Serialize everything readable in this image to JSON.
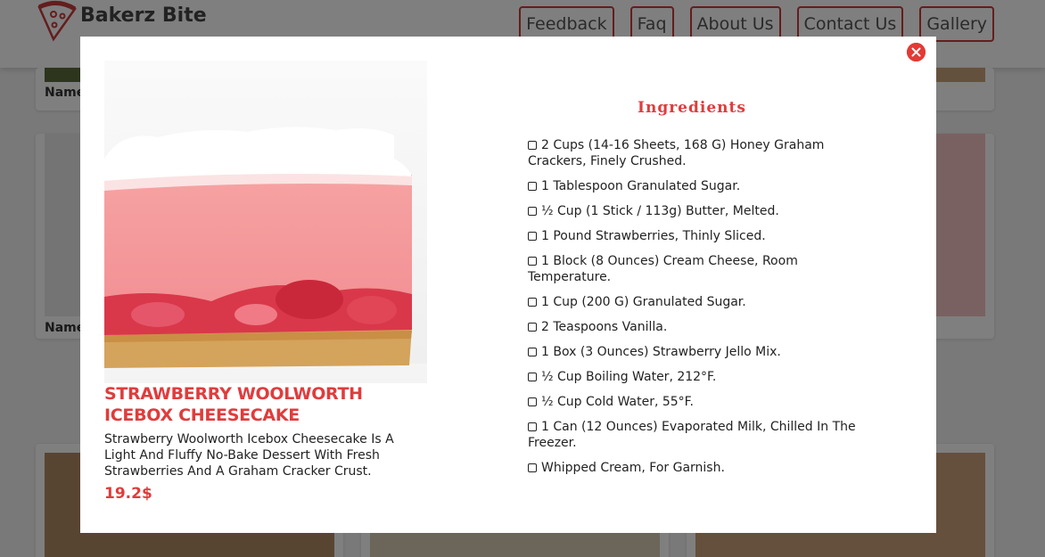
{
  "navbar": {
    "brand": "Bakerz Bite",
    "links": [
      "Feedback",
      "Faq",
      "About Us",
      "Contact Us",
      "Gallery"
    ]
  },
  "background_cards": {
    "name_label_1": "Name",
    "name_label_2": "Name"
  },
  "modal": {
    "product": {
      "title": "Strawberry Woolworth Icebox Cheesecake",
      "description": "Strawberry Woolworth Icebox Cheesecake Is A Light And Fluffy No-Bake Dessert With Fresh Strawberries And A Graham Cracker Crust.",
      "price": "19.2$"
    },
    "ingredients_title": "Ingredients",
    "ingredients": [
      "2 Cups (14-16 Sheets, 168 G) Honey Graham Crackers, Finely Crushed.",
      "1 Tablespoon Granulated Sugar.",
      "½ Cup (1 Stick / 113g) Butter, Melted.",
      "1 Pound Strawberries, Thinly Sliced.",
      "1 Block (8 Ounces) Cream Cheese, Room Temperature.",
      "1 Cup (200 G) Granulated Sugar.",
      "2 Teaspoons Vanilla.",
      "1 Box (3 Ounces) Strawberry Jello Mix.",
      "½ Cup Boiling Water, 212°F.",
      "½ Cup Cold Water, 55°F.",
      "1 Can (12 Ounces) Evaporated Milk, Chilled In The Freezer.",
      "Whipped Cream, For Garnish."
    ]
  },
  "colors": {
    "accent": "#e03c3c",
    "close_button": "#e53935",
    "overlay": "rgba(0,0,0,0.5)"
  },
  "icons": {
    "logo": "pizza-slice-icon",
    "close": "close-icon",
    "checkbox": "checkbox-icon"
  }
}
